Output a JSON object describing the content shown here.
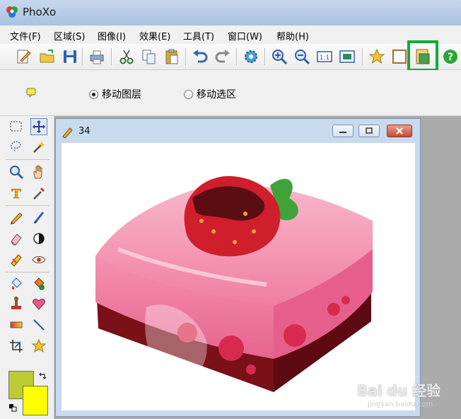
{
  "app": {
    "title": "PhoXo"
  },
  "menu": [
    "文件(F)",
    "区域(S)",
    "图像(I)",
    "效果(E)",
    "工具(T)",
    "窗口(W)",
    "帮助(H)"
  ],
  "toolbar": {
    "buttons": [
      "new",
      "open",
      "save",
      "print",
      "cut",
      "copy",
      "paste",
      "undo",
      "redo",
      "settings",
      "zoom-in",
      "zoom-out",
      "actual-size",
      "fit-window",
      "favorites",
      "frame",
      "move-image",
      "help"
    ],
    "highlighted": "move-image",
    "highlight_color": "#18a83c"
  },
  "options": {
    "move_layer": "移动图层",
    "move_selection": "移动选区",
    "selected": "move_layer"
  },
  "document": {
    "title": "34"
  },
  "colors": {
    "foreground": "#bccb2f",
    "background": "#ffff00"
  },
  "watermark": {
    "main": "Bai du 经验",
    "sub": "jingyan.baidu.com"
  }
}
